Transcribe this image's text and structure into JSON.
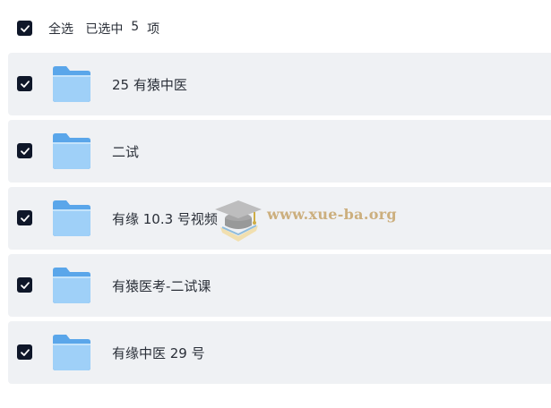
{
  "header": {
    "select_all_label": "全选",
    "selected_prefix": "已选中",
    "selected_count": "5",
    "selected_suffix": "项",
    "all_checked": true
  },
  "items": [
    {
      "label": "25 有猿中医",
      "checked": true,
      "icon": "folder-icon"
    },
    {
      "label": "二试",
      "checked": true,
      "icon": "folder-icon"
    },
    {
      "label": "有缘 10.3 号视频",
      "checked": true,
      "icon": "folder-icon"
    },
    {
      "label": "有猿医考-二试课",
      "checked": true,
      "icon": "folder-icon"
    },
    {
      "label": "有缘中医 29 号",
      "checked": true,
      "icon": "folder-icon"
    }
  ],
  "watermark": {
    "text": "www.xue-ba.org",
    "icon": "graduation-cap-icon"
  },
  "colors": {
    "checkbox": "#0f1729",
    "row_bg": "#eff1f4",
    "folder_top": "#5aa6ea",
    "folder_front": "#9fd0f8"
  }
}
